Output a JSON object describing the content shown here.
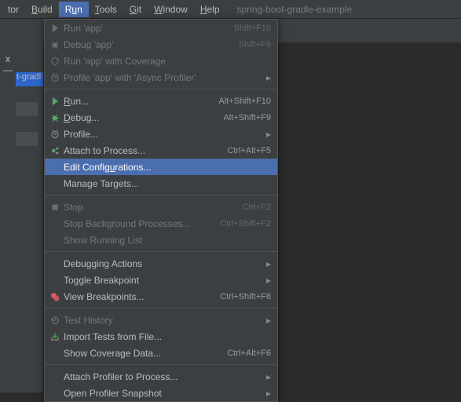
{
  "menubar": {
    "items": [
      {
        "pre": "tor",
        "u": "",
        "post": ""
      },
      {
        "pre": "",
        "u": "B",
        "post": "uild"
      },
      {
        "pre": "R",
        "u": "u",
        "post": "n"
      },
      {
        "pre": "",
        "u": "T",
        "post": "ools"
      },
      {
        "pre": "",
        "u": "G",
        "post": "it"
      },
      {
        "pre": "",
        "u": "W",
        "post": "indow"
      },
      {
        "pre": "",
        "u": "H",
        "post": "elp"
      }
    ],
    "context": "spring-boot-gradle-example"
  },
  "sidebar": {
    "tab_label": "x  —",
    "tree_label": "t-gradl"
  },
  "menu": {
    "items": [
      {
        "icon": "play",
        "label": "Run 'app'",
        "shortcut": "Shift+F10",
        "disabled": true
      },
      {
        "icon": "bug",
        "label": "Debug 'app'",
        "shortcut": "Shift+F9",
        "disabled": true
      },
      {
        "icon": "shield",
        "label": "Run 'app' with Coverage",
        "disabled": true
      },
      {
        "icon": "clock",
        "label": "Profile 'app' with 'Async Profiler'",
        "submenu": true,
        "disabled": true
      },
      {
        "sep": true
      },
      {
        "icon": "play",
        "label_u": "R",
        "label_post": "un...",
        "shortcut": "Alt+Shift+F10"
      },
      {
        "icon": "bug",
        "label_u": "D",
        "label_post": "ebug...",
        "shortcut": "Alt+Shift+F9"
      },
      {
        "icon": "clock",
        "label": "Profile...",
        "submenu": true
      },
      {
        "icon": "attach",
        "label": "Attach to Process...",
        "shortcut": "Ctrl+Alt+F5"
      },
      {
        "icon": "",
        "label_pre": "Edit Config",
        "label_u": "u",
        "label_post": "rations...",
        "selected": true
      },
      {
        "icon": "",
        "label": "Manage Targets..."
      },
      {
        "sep": true
      },
      {
        "icon": "stop",
        "label": "Stop",
        "shortcut": "Ctrl+F2",
        "disabled": true
      },
      {
        "icon": "",
        "label": "Stop Background Processes...",
        "shortcut": "Ctrl+Shift+F2",
        "disabled": true
      },
      {
        "icon": "",
        "label": "Show Running List",
        "disabled": true
      },
      {
        "sep": true
      },
      {
        "icon": "",
        "label": "Debugging Actions",
        "submenu": true
      },
      {
        "icon": "",
        "label": "Toggle Breakpoint",
        "submenu": true
      },
      {
        "icon": "breakpoints",
        "label": "View Breakpoints...",
        "shortcut": "Ctrl+Shift+F8"
      },
      {
        "sep": true
      },
      {
        "icon": "history",
        "label": "Test History",
        "submenu": true,
        "disabled": true
      },
      {
        "icon": "import",
        "label": "Import Tests from File..."
      },
      {
        "icon": "",
        "label": "Show Coverage Data...",
        "shortcut": "Ctrl+Alt+F6"
      },
      {
        "sep": true
      },
      {
        "icon": "",
        "label": "Attach Profiler to Process...",
        "submenu": true
      },
      {
        "icon": "",
        "label": "Open Profiler Snapshot",
        "submenu": true
      }
    ]
  }
}
